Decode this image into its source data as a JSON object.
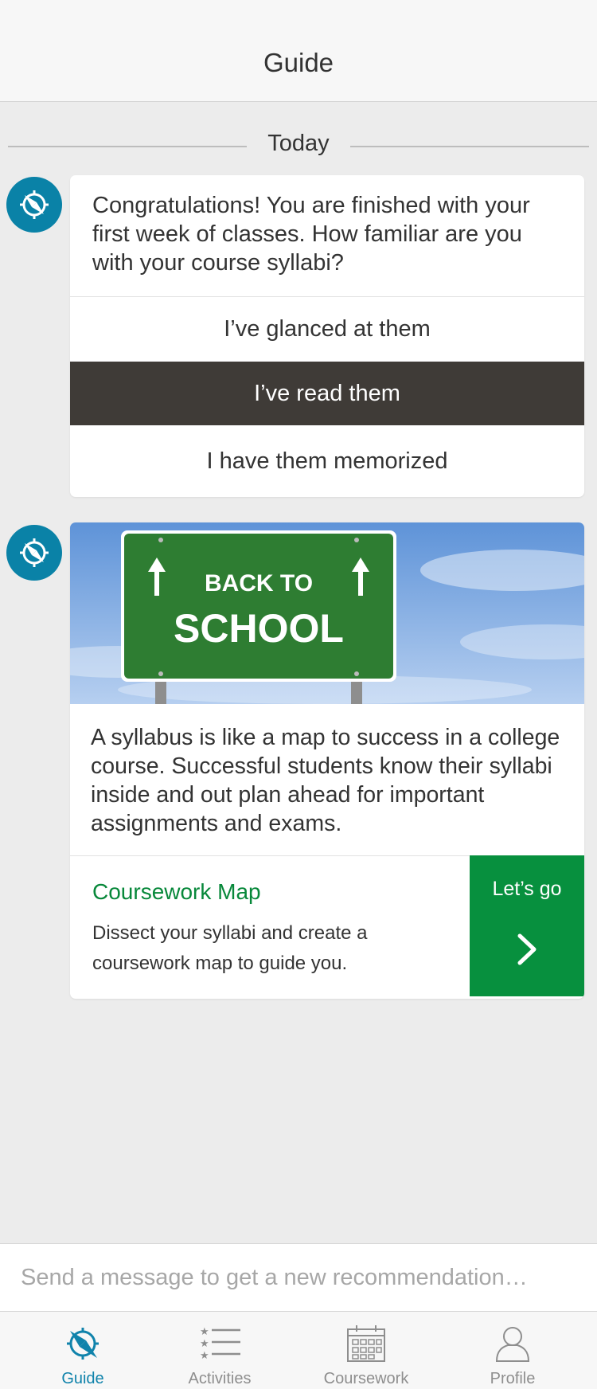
{
  "header": {
    "title": "Guide"
  },
  "feed": {
    "day_label": "Today"
  },
  "question_card": {
    "text": "Congratulations! You are finished with your first week of classes. How familiar are you with your course syllabi?",
    "options": [
      {
        "label": "I’ve glanced at them",
        "selected": false
      },
      {
        "label": "I’ve read them",
        "selected": true
      },
      {
        "label": "I have them memorized",
        "selected": false
      }
    ]
  },
  "tip_card": {
    "banner": {
      "sign_line1": "BACK TO",
      "sign_line2": "SCHOOL",
      "sign_color": "#2e7d32"
    },
    "text": "A syllabus is like a map to success in a college course. Successful students know their syllabi inside and out plan ahead for important assignments and exams.",
    "cta": {
      "title": "Coursework Map",
      "description": "Dissect your syllabi and create a coursework map to guide you.",
      "button_label": "Let’s go",
      "button_icon": "chevron-right-icon"
    }
  },
  "composer": {
    "placeholder": "Send a message to get a new recommendation…"
  },
  "tabbar": {
    "tabs": [
      {
        "label": "Guide",
        "icon": "compass-icon",
        "active": true
      },
      {
        "label": "Activities",
        "icon": "list-icon",
        "active": false
      },
      {
        "label": "Coursework",
        "icon": "calendar-icon",
        "active": false
      },
      {
        "label": "Profile",
        "icon": "person-icon",
        "active": false
      }
    ]
  },
  "colors": {
    "accent_blue": "#1083ab",
    "accent_green": "#07903e",
    "selected_option": "#3f3b37",
    "background": "#ececec"
  }
}
